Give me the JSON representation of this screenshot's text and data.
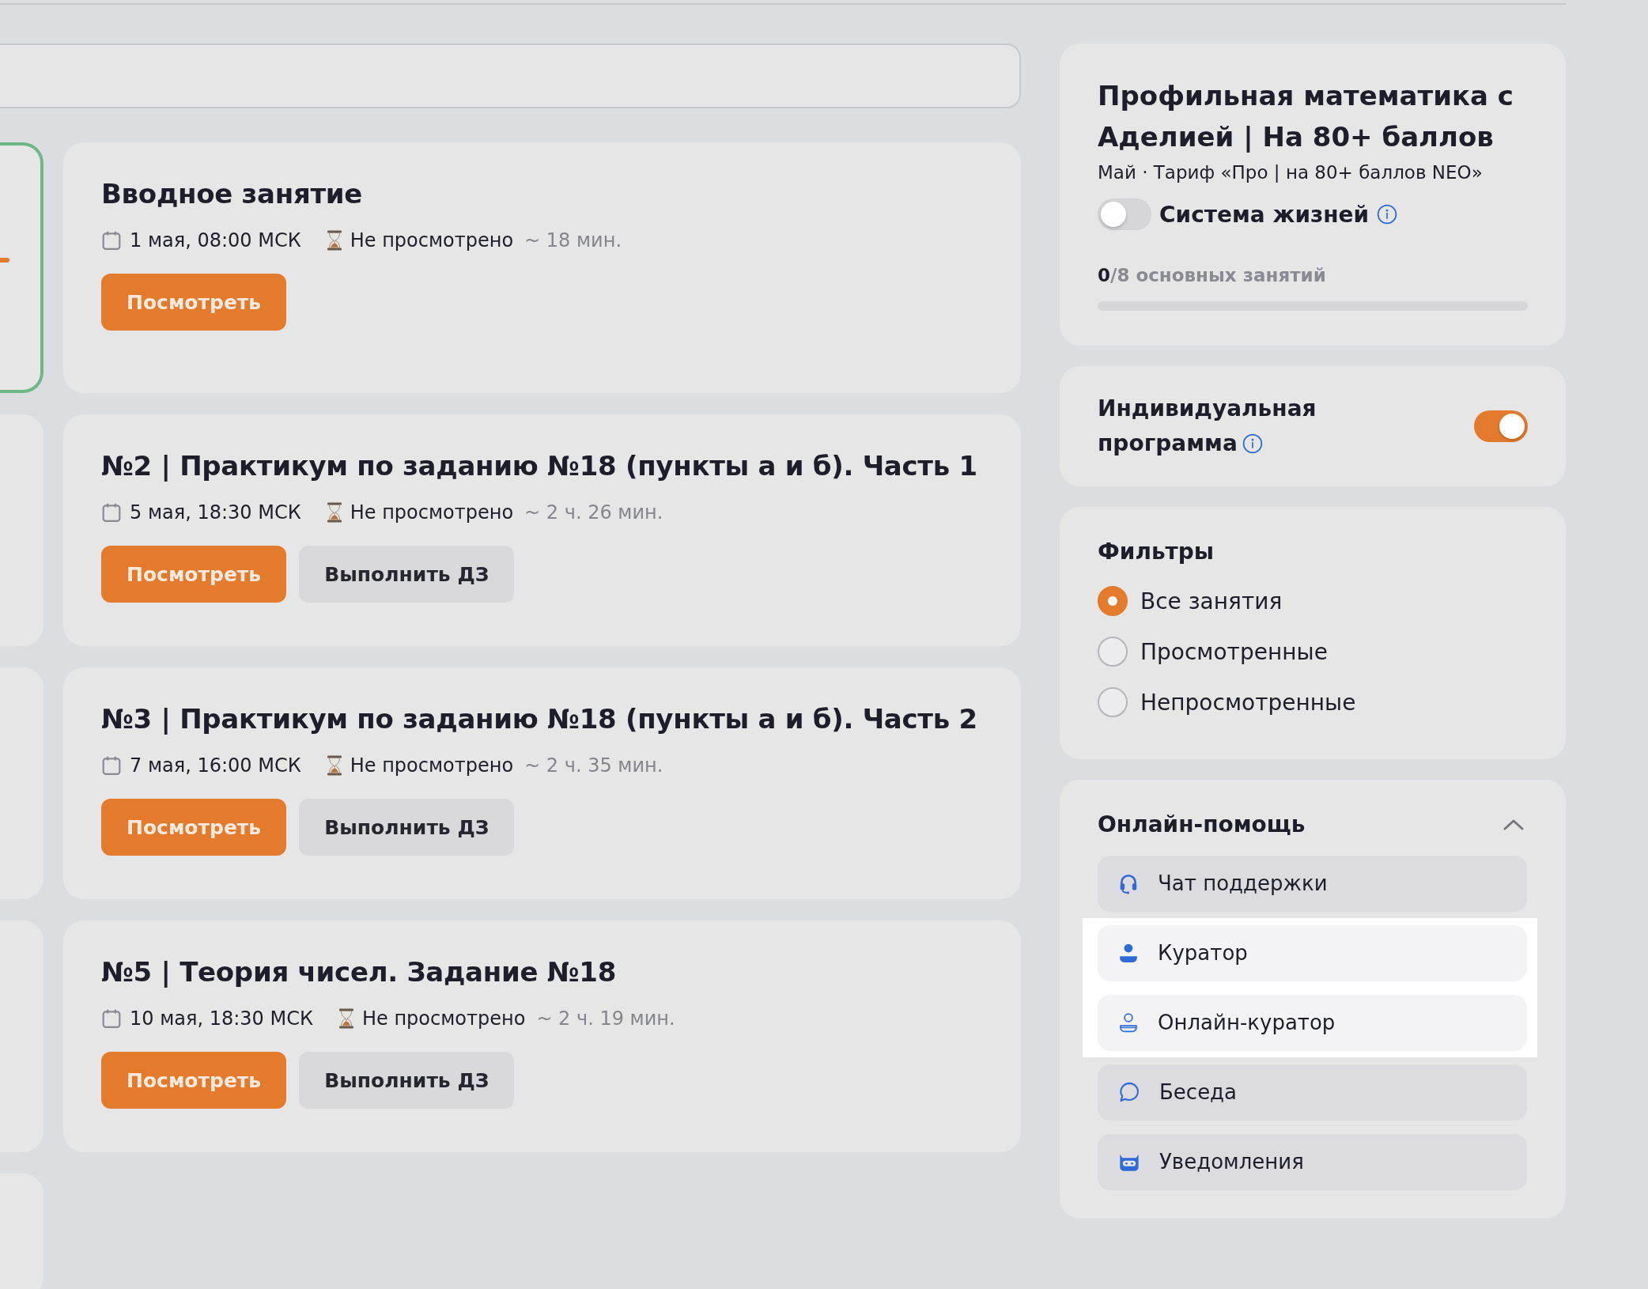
{
  "thumbnails": [
    {
      "selected": true
    },
    {
      "selected": false
    },
    {
      "selected": false
    },
    {
      "selected": false
    },
    {
      "selected": false
    }
  ],
  "lessons": [
    {
      "title": "Вводное занятие",
      "date": "1 мая, 08:00 МСК",
      "status": "Не просмотрено",
      "duration": "~ 18 мин.",
      "buttons": [
        {
          "label": "Посмотреть",
          "kind": "primary"
        }
      ]
    },
    {
      "title": "№2 | Практикум по заданию №18 (пункты а и б). Часть 1",
      "date": "5 мая, 18:30 МСК",
      "status": "Не просмотрено",
      "duration": "~ 2 ч. 26 мин.",
      "buttons": [
        {
          "label": "Посмотреть",
          "kind": "primary"
        },
        {
          "label": "Выполнить ДЗ",
          "kind": "secondary"
        }
      ]
    },
    {
      "title": "№3 | Практикум по заданию №18 (пункты а и б). Часть 2",
      "date": "7 мая, 16:00 МСК",
      "status": "Не просмотрено",
      "duration": "~ 2 ч. 35 мин.",
      "buttons": [
        {
          "label": "Посмотреть",
          "kind": "primary"
        },
        {
          "label": "Выполнить ДЗ",
          "kind": "secondary"
        }
      ]
    },
    {
      "title": "№5 | Теория чисел. Задание №18",
      "date": "10 мая, 18:30 МСК",
      "status": "Не просмотрено",
      "duration": "~ 2 ч. 19 мин.",
      "buttons": [
        {
          "label": "Посмотреть",
          "kind": "primary"
        },
        {
          "label": "Выполнить ДЗ",
          "kind": "secondary"
        }
      ]
    }
  ],
  "course": {
    "title": "Профильная математика с Аделией | На 80+ баллов",
    "subtitle": "Май · Тариф «Про | на 80+ баллов NEO»",
    "lives_toggle": {
      "label": "Система жизней",
      "on": false
    },
    "progress": {
      "count": "0",
      "label": "/8 основных занятий",
      "level": 0
    }
  },
  "individual_program": {
    "label": "Индивидуальная программа",
    "on": true
  },
  "filters": {
    "title": "Фильтры",
    "options": [
      {
        "label": "Все занятия",
        "selected": true
      },
      {
        "label": "Просмотренные",
        "selected": false
      },
      {
        "label": "Непросмотренные",
        "selected": false
      }
    ]
  },
  "online_help": {
    "title": "Онлайн-помощь",
    "expanded": true,
    "items": [
      {
        "label": "Чат поддержки",
        "highlighted": false
      },
      {
        "label": "Куратор",
        "highlighted": true
      },
      {
        "label": "Онлайн-куратор",
        "highlighted": true
      },
      {
        "label": "Беседа",
        "highlighted": false
      },
      {
        "label": "Уведомления",
        "highlighted": false
      }
    ]
  }
}
